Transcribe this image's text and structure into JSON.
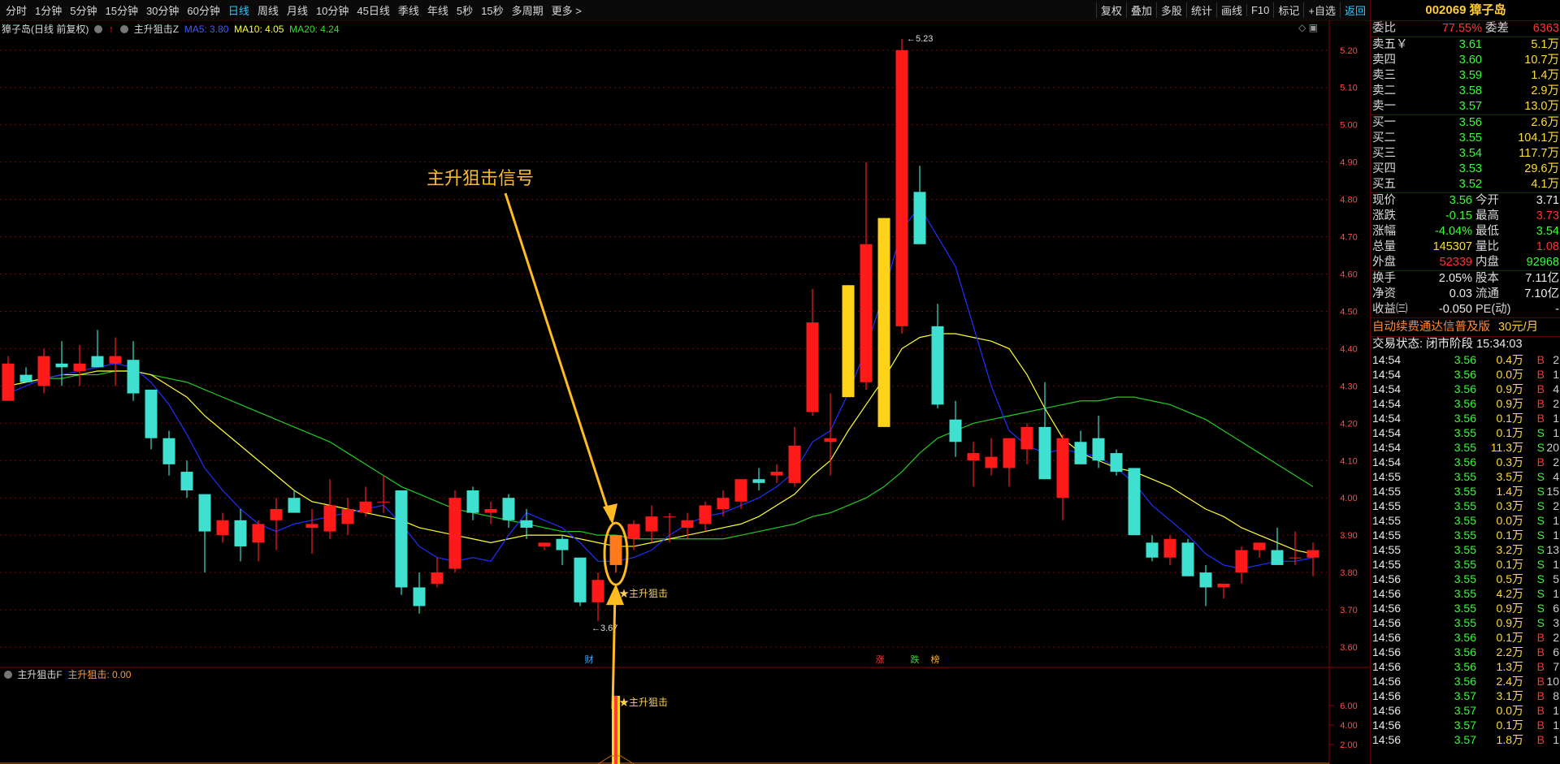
{
  "toolbar": {
    "periods": [
      "分时",
      "1分钟",
      "5分钟",
      "15分钟",
      "30分钟",
      "60分钟",
      "日线",
      "周线",
      "月线",
      "10分钟",
      "45日线",
      "季线",
      "年线",
      "5秒",
      "15秒",
      "多周期",
      "更多 >"
    ],
    "active_period": "日线",
    "ops": [
      "复权",
      "叠加",
      "多股",
      "统计",
      "画线",
      "F10",
      "标记",
      "+自选",
      "返回"
    ]
  },
  "header": {
    "stock_title": "獐子岛(日线 前复权)",
    "indicator_name": "主升狙击Z",
    "ma5_label": "MA5: 3.80",
    "ma10_label": "MA10: 4.05",
    "ma20_label": "MA20: 4.24"
  },
  "sub_header": {
    "indicator_name": "主升狙击F",
    "value_label": "主升狙击: 0.00"
  },
  "annotation": {
    "text": "主升狙击信号",
    "signal_label_main": "主升狙击",
    "signal_label_sub": "主升狙击"
  },
  "markers": {
    "high_label": "5.23",
    "low_label": "3.67",
    "bottom_icons": [
      "财",
      "涨",
      "跌",
      "榜"
    ]
  },
  "colors": {
    "up": "#ff1a1a",
    "down": "#3fe0d0",
    "ma5": "#2030ff",
    "ma10": "#ffff33",
    "ma20": "#22cc22",
    "grid": "#7a0000",
    "annotation": "#ffbb22"
  },
  "chart_data": {
    "type": "candlestick",
    "ylim": [
      3.55,
      5.28
    ],
    "y_ticks": [
      "5.20",
      "5.10",
      "5.00",
      "4.90",
      "4.80",
      "4.70",
      "4.60",
      "4.50",
      "4.40",
      "4.30",
      "4.20",
      "4.10",
      "4.00",
      "3.90",
      "3.80",
      "3.70",
      "3.60"
    ],
    "candles": [
      {
        "o": 4.26,
        "h": 4.38,
        "l": 4.26,
        "c": 4.36
      },
      {
        "o": 4.33,
        "h": 4.35,
        "l": 4.32,
        "c": 4.31
      },
      {
        "o": 4.3,
        "h": 4.4,
        "l": 4.28,
        "c": 4.38
      },
      {
        "o": 4.36,
        "h": 4.42,
        "l": 4.3,
        "c": 4.35
      },
      {
        "o": 4.34,
        "h": 4.41,
        "l": 4.3,
        "c": 4.36
      },
      {
        "o": 4.38,
        "h": 4.45,
        "l": 4.35,
        "c": 4.35
      },
      {
        "o": 4.36,
        "h": 4.43,
        "l": 4.3,
        "c": 4.38
      },
      {
        "o": 4.37,
        "h": 4.42,
        "l": 4.26,
        "c": 4.28
      },
      {
        "o": 4.29,
        "h": 4.29,
        "l": 4.13,
        "c": 4.16
      },
      {
        "o": 4.16,
        "h": 4.18,
        "l": 4.06,
        "c": 4.09
      },
      {
        "o": 4.07,
        "h": 4.1,
        "l": 4.0,
        "c": 4.02
      },
      {
        "o": 4.01,
        "h": 4.01,
        "l": 3.8,
        "c": 3.91
      },
      {
        "o": 3.9,
        "h": 3.96,
        "l": 3.88,
        "c": 3.94
      },
      {
        "o": 3.94,
        "h": 3.97,
        "l": 3.83,
        "c": 3.87
      },
      {
        "o": 3.88,
        "h": 3.94,
        "l": 3.83,
        "c": 3.93
      },
      {
        "o": 3.94,
        "h": 4.0,
        "l": 3.86,
        "c": 3.97
      },
      {
        "o": 4.0,
        "h": 4.02,
        "l": 3.96,
        "c": 3.96
      },
      {
        "o": 3.92,
        "h": 3.97,
        "l": 3.85,
        "c": 3.93
      },
      {
        "o": 3.91,
        "h": 4.05,
        "l": 3.89,
        "c": 3.98
      },
      {
        "o": 3.93,
        "h": 4.0,
        "l": 3.9,
        "c": 3.97
      },
      {
        "o": 3.96,
        "h": 4.03,
        "l": 3.95,
        "c": 3.99
      },
      {
        "o": 3.99,
        "h": 4.06,
        "l": 3.96,
        "c": 3.99
      },
      {
        "o": 4.02,
        "h": 4.02,
        "l": 3.74,
        "c": 3.76
      },
      {
        "o": 3.76,
        "h": 3.8,
        "l": 3.69,
        "c": 3.71
      },
      {
        "o": 3.77,
        "h": 3.84,
        "l": 3.76,
        "c": 3.8
      },
      {
        "o": 3.81,
        "h": 4.02,
        "l": 3.8,
        "c": 4.0
      },
      {
        "o": 4.02,
        "h": 4.03,
        "l": 3.94,
        "c": 3.96
      },
      {
        "o": 3.96,
        "h": 3.99,
        "l": 3.93,
        "c": 3.97
      },
      {
        "o": 4.0,
        "h": 4.01,
        "l": 3.92,
        "c": 3.94
      },
      {
        "o": 3.94,
        "h": 3.97,
        "l": 3.89,
        "c": 3.92
      },
      {
        "o": 3.87,
        "h": 3.88,
        "l": 3.86,
        "c": 3.88
      },
      {
        "o": 3.89,
        "h": 3.9,
        "l": 3.82,
        "c": 3.86
      },
      {
        "o": 3.84,
        "h": 3.84,
        "l": 3.71,
        "c": 3.72
      },
      {
        "o": 3.72,
        "h": 3.8,
        "l": 3.67,
        "c": 3.78
      },
      {
        "o": 3.82,
        "h": 3.9,
        "l": 3.8,
        "c": 3.9
      },
      {
        "o": 3.89,
        "h": 3.94,
        "l": 3.86,
        "c": 3.93
      },
      {
        "o": 3.91,
        "h": 3.98,
        "l": 3.88,
        "c": 3.95
      },
      {
        "o": 3.95,
        "h": 3.96,
        "l": 3.88,
        "c": 3.95
      },
      {
        "o": 3.92,
        "h": 3.96,
        "l": 3.89,
        "c": 3.94
      },
      {
        "o": 3.93,
        "h": 3.99,
        "l": 3.91,
        "c": 3.98
      },
      {
        "o": 3.97,
        "h": 4.02,
        "l": 3.95,
        "c": 4.0
      },
      {
        "o": 3.99,
        "h": 4.05,
        "l": 3.97,
        "c": 4.05
      },
      {
        "o": 4.05,
        "h": 4.08,
        "l": 4.02,
        "c": 4.04
      },
      {
        "o": 4.06,
        "h": 4.09,
        "l": 4.04,
        "c": 4.07
      },
      {
        "o": 4.04,
        "h": 4.19,
        "l": 4.03,
        "c": 4.14
      },
      {
        "o": 4.23,
        "h": 4.56,
        "l": 4.22,
        "c": 4.47
      },
      {
        "o": 4.15,
        "h": 4.28,
        "l": 4.06,
        "c": 4.16
      },
      {
        "o": 4.27,
        "h": 4.57,
        "l": 4.27,
        "c": 4.57,
        "yellow": true
      },
      {
        "o": 4.31,
        "h": 4.9,
        "l": 4.29,
        "c": 4.68
      },
      {
        "o": 4.19,
        "h": 4.75,
        "l": 4.19,
        "c": 4.75,
        "yellow": true
      },
      {
        "o": 4.46,
        "h": 5.23,
        "l": 4.44,
        "c": 5.2
      },
      {
        "o": 4.82,
        "h": 4.89,
        "l": 4.68,
        "c": 4.68
      },
      {
        "o": 4.46,
        "h": 4.52,
        "l": 4.24,
        "c": 4.25
      },
      {
        "o": 4.21,
        "h": 4.26,
        "l": 4.11,
        "c": 4.15
      },
      {
        "o": 4.1,
        "h": 4.15,
        "l": 4.03,
        "c": 4.12
      },
      {
        "o": 4.08,
        "h": 4.16,
        "l": 4.06,
        "c": 4.11
      },
      {
        "o": 4.08,
        "h": 4.16,
        "l": 4.03,
        "c": 4.16
      },
      {
        "o": 4.13,
        "h": 4.2,
        "l": 4.09,
        "c": 4.19
      },
      {
        "o": 4.19,
        "h": 4.31,
        "l": 4.05,
        "c": 4.05
      },
      {
        "o": 4.0,
        "h": 4.17,
        "l": 3.94,
        "c": 4.16
      },
      {
        "o": 4.15,
        "h": 4.18,
        "l": 4.09,
        "c": 4.09
      },
      {
        "o": 4.16,
        "h": 4.22,
        "l": 4.08,
        "c": 4.1
      },
      {
        "o": 4.12,
        "h": 4.13,
        "l": 4.06,
        "c": 4.07
      },
      {
        "o": 4.08,
        "h": 4.08,
        "l": 3.9,
        "c": 3.9
      },
      {
        "o": 3.88,
        "h": 3.9,
        "l": 3.83,
        "c": 3.84
      },
      {
        "o": 3.84,
        "h": 3.9,
        "l": 3.82,
        "c": 3.89
      },
      {
        "o": 3.88,
        "h": 3.89,
        "l": 3.79,
        "c": 3.79
      },
      {
        "o": 3.8,
        "h": 3.82,
        "l": 3.71,
        "c": 3.76
      },
      {
        "o": 3.76,
        "h": 3.77,
        "l": 3.73,
        "c": 3.77
      },
      {
        "o": 3.8,
        "h": 3.87,
        "l": 3.77,
        "c": 3.86
      },
      {
        "o": 3.86,
        "h": 3.88,
        "l": 3.84,
        "c": 3.88
      },
      {
        "o": 3.86,
        "h": 3.92,
        "l": 3.82,
        "c": 3.82
      },
      {
        "o": 3.84,
        "h": 3.91,
        "l": 3.82,
        "c": 3.84
      },
      {
        "o": 3.84,
        "h": 3.88,
        "l": 3.79,
        "c": 3.86
      }
    ],
    "ma5": [
      4.28,
      4.3,
      4.32,
      4.33,
      4.34,
      4.35,
      4.36,
      4.35,
      4.31,
      4.25,
      4.17,
      4.08,
      4.02,
      3.97,
      3.93,
      3.91,
      3.93,
      3.94,
      3.95,
      3.96,
      3.97,
      3.98,
      3.93,
      3.87,
      3.84,
      3.83,
      3.84,
      3.83,
      3.9,
      3.96,
      3.94,
      3.92,
      3.88,
      3.83,
      3.83,
      3.84,
      3.86,
      3.9,
      3.93,
      3.95,
      3.96,
      3.98,
      4.0,
      4.03,
      4.07,
      4.15,
      4.18,
      4.28,
      4.4,
      4.55,
      4.72,
      4.78,
      4.7,
      4.62,
      4.46,
      4.3,
      4.18,
      4.14,
      4.12,
      4.13,
      4.12,
      4.11,
      4.08,
      4.04,
      3.98,
      3.94,
      3.9,
      3.85,
      3.82,
      3.81,
      3.82,
      3.83,
      3.83,
      3.84
    ],
    "ma10": [
      4.3,
      4.31,
      4.32,
      4.33,
      4.33,
      4.34,
      4.34,
      4.34,
      4.33,
      4.3,
      4.27,
      4.22,
      4.18,
      4.14,
      4.1,
      4.06,
      4.02,
      3.99,
      3.98,
      3.97,
      3.96,
      3.95,
      3.94,
      3.92,
      3.91,
      3.9,
      3.89,
      3.88,
      3.89,
      3.9,
      3.9,
      3.9,
      3.89,
      3.88,
      3.87,
      3.87,
      3.88,
      3.89,
      3.9,
      3.91,
      3.92,
      3.93,
      3.95,
      3.98,
      4.01,
      4.06,
      4.1,
      4.18,
      4.25,
      4.32,
      4.4,
      4.43,
      4.44,
      4.44,
      4.43,
      4.42,
      4.4,
      4.33,
      4.24,
      4.16,
      4.12,
      4.1,
      4.08,
      4.07,
      4.05,
      4.03,
      4.0,
      3.97,
      3.95,
      3.92,
      3.9,
      3.88,
      3.86,
      3.85
    ],
    "ma20": [
      4.3,
      4.31,
      4.32,
      4.32,
      4.33,
      4.33,
      4.34,
      4.34,
      4.33,
      4.32,
      4.31,
      4.29,
      4.27,
      4.25,
      4.23,
      4.21,
      4.19,
      4.17,
      4.15,
      4.12,
      4.09,
      4.06,
      4.03,
      4.01,
      3.99,
      3.97,
      3.96,
      3.95,
      3.94,
      3.93,
      3.92,
      3.91,
      3.91,
      3.9,
      3.9,
      3.89,
      3.89,
      3.89,
      3.89,
      3.89,
      3.89,
      3.9,
      3.91,
      3.92,
      3.93,
      3.95,
      3.96,
      3.98,
      4.0,
      4.03,
      4.07,
      4.12,
      4.16,
      4.18,
      4.2,
      4.21,
      4.22,
      4.23,
      4.24,
      4.25,
      4.26,
      4.26,
      4.27,
      4.27,
      4.26,
      4.25,
      4.23,
      4.21,
      4.18,
      4.15,
      4.12,
      4.09,
      4.06,
      4.03
    ],
    "signal_index": 34,
    "sub_ylim": [
      0,
      8
    ],
    "sub_y_ticks": [
      "6.00",
      "4.00",
      "2.00"
    ],
    "sub_signal_value": 7.0
  },
  "quote": {
    "code_name": "002069 獐子岛",
    "weibi_label": "委比",
    "weibi_value": "77.55%",
    "weicha_label": "委差",
    "weicha_value": "6363",
    "sells": [
      {
        "label": "卖五￥",
        "price": "3.61",
        "vol": "5.1万"
      },
      {
        "label": "卖四",
        "price": "3.60",
        "vol": "10.7万"
      },
      {
        "label": "卖三",
        "price": "3.59",
        "vol": "1.4万"
      },
      {
        "label": "卖二",
        "price": "3.58",
        "vol": "2.9万"
      },
      {
        "label": "卖一",
        "price": "3.57",
        "vol": "13.0万"
      }
    ],
    "buys": [
      {
        "label": "买一",
        "price": "3.56",
        "vol": "2.6万"
      },
      {
        "label": "买二",
        "price": "3.55",
        "vol": "104.1万"
      },
      {
        "label": "买三",
        "price": "3.54",
        "vol": "117.7万"
      },
      {
        "label": "买四",
        "price": "3.53",
        "vol": "29.6万"
      },
      {
        "label": "买五",
        "price": "3.52",
        "vol": "4.1万"
      }
    ],
    "stats1": [
      {
        "l1": "现价",
        "v1": "3.56",
        "c1": "green",
        "l2": "今开",
        "v2": "3.71",
        "c2": "white"
      },
      {
        "l1": "涨跌",
        "v1": "-0.15",
        "c1": "green",
        "l2": "最高",
        "v2": "3.73",
        "c2": "red"
      },
      {
        "l1": "涨幅",
        "v1": "-4.04%",
        "c1": "green",
        "l2": "最低",
        "v2": "3.54",
        "c2": "green"
      },
      {
        "l1": "总量",
        "v1": "145307",
        "c1": "yellow",
        "l2": "量比",
        "v2": "1.08",
        "c2": "red"
      },
      {
        "l1": "外盘",
        "v1": "52339",
        "c1": "red",
        "l2": "内盘",
        "v2": "92968",
        "c2": "green"
      }
    ],
    "stats2": [
      {
        "l1": "换手",
        "v1": "2.05%",
        "c1": "white",
        "l2": "股本",
        "v2": "7.11亿",
        "c2": "white"
      },
      {
        "l1": "净资",
        "v1": "0.03",
        "c1": "white",
        "l2": "流通",
        "v2": "7.10亿",
        "c2": "white"
      },
      {
        "l1": "收益㈢",
        "v1": "-0.050",
        "c1": "white",
        "l2": "PE(动)",
        "v2": "-",
        "c2": "white"
      }
    ],
    "ad_text": "自动续费通达信普及版",
    "ad_price": "30元/月",
    "trade_status": "交易状态: 闭市阶段 15:34:03",
    "ticks": [
      {
        "t": "14:54",
        "p": "3.56",
        "v": "0.4万",
        "bs": "B",
        "n": "2"
      },
      {
        "t": "14:54",
        "p": "3.56",
        "v": "0.0万",
        "bs": "B",
        "n": "1"
      },
      {
        "t": "14:54",
        "p": "3.56",
        "v": "0.9万",
        "bs": "B",
        "n": "4"
      },
      {
        "t": "14:54",
        "p": "3.56",
        "v": "0.9万",
        "bs": "B",
        "n": "2"
      },
      {
        "t": "14:54",
        "p": "3.56",
        "v": "0.1万",
        "bs": "B",
        "n": "1"
      },
      {
        "t": "14:54",
        "p": "3.55",
        "v": "0.1万",
        "bs": "S",
        "n": "1"
      },
      {
        "t": "14:54",
        "p": "3.55",
        "v": "11.3万",
        "bs": "S",
        "n": "20"
      },
      {
        "t": "14:54",
        "p": "3.56",
        "v": "0.3万",
        "bs": "B",
        "n": "2"
      },
      {
        "t": "14:55",
        "p": "3.55",
        "v": "3.5万",
        "bs": "S",
        "n": "4"
      },
      {
        "t": "14:55",
        "p": "3.55",
        "v": "1.4万",
        "bs": "S",
        "n": "15"
      },
      {
        "t": "14:55",
        "p": "3.55",
        "v": "0.3万",
        "bs": "S",
        "n": "2"
      },
      {
        "t": "14:55",
        "p": "3.55",
        "v": "0.0万",
        "bs": "S",
        "n": "1"
      },
      {
        "t": "14:55",
        "p": "3.55",
        "v": "0.1万",
        "bs": "S",
        "n": "1"
      },
      {
        "t": "14:55",
        "p": "3.55",
        "v": "3.2万",
        "bs": "S",
        "n": "13"
      },
      {
        "t": "14:55",
        "p": "3.55",
        "v": "0.1万",
        "bs": "S",
        "n": "1"
      },
      {
        "t": "14:56",
        "p": "3.55",
        "v": "0.5万",
        "bs": "S",
        "n": "5"
      },
      {
        "t": "14:56",
        "p": "3.55",
        "v": "4.2万",
        "bs": "S",
        "n": "1"
      },
      {
        "t": "14:56",
        "p": "3.55",
        "v": "0.9万",
        "bs": "S",
        "n": "6"
      },
      {
        "t": "14:56",
        "p": "3.55",
        "v": "0.9万",
        "bs": "S",
        "n": "3"
      },
      {
        "t": "14:56",
        "p": "3.56",
        "v": "0.1万",
        "bs": "B",
        "n": "2"
      },
      {
        "t": "14:56",
        "p": "3.56",
        "v": "2.2万",
        "bs": "B",
        "n": "6"
      },
      {
        "t": "14:56",
        "p": "3.56",
        "v": "1.3万",
        "bs": "B",
        "n": "7"
      },
      {
        "t": "14:56",
        "p": "3.56",
        "v": "2.4万",
        "bs": "B",
        "n": "10"
      },
      {
        "t": "14:56",
        "p": "3.57",
        "v": "3.1万",
        "bs": "B",
        "n": "8"
      },
      {
        "t": "14:56",
        "p": "3.57",
        "v": "0.0万",
        "bs": "B",
        "n": "1"
      },
      {
        "t": "14:56",
        "p": "3.57",
        "v": "0.1万",
        "bs": "B",
        "n": "1"
      },
      {
        "t": "14:56",
        "p": "3.57",
        "v": "1.8万",
        "bs": "B",
        "n": "1"
      }
    ]
  }
}
